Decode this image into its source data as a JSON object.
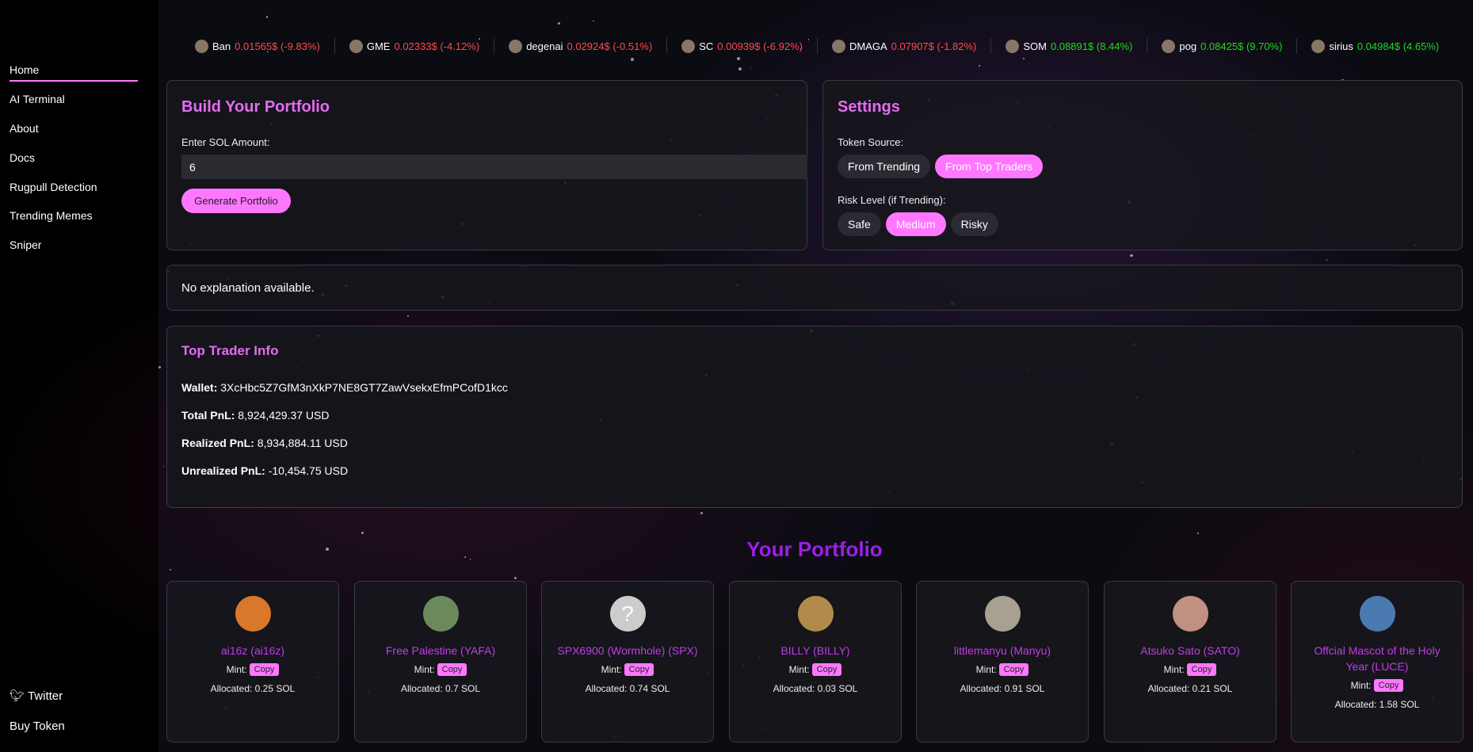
{
  "colors": {
    "accent": "#ff77ff",
    "title": "#e46cf2",
    "portfolio_title": "#9b1fe8",
    "negative": "#ff4a4a",
    "positive": "#1bdc1b"
  },
  "sidebar": {
    "items": [
      {
        "label": "Home",
        "active": true
      },
      {
        "label": "AI Terminal"
      },
      {
        "label": "About"
      },
      {
        "label": "Docs"
      },
      {
        "label": "Rugpull Detection"
      },
      {
        "label": "Trending Memes"
      },
      {
        "label": "Sniper"
      }
    ],
    "twitter": "Twitter",
    "twitter_icon": "bird-icon",
    "buy": "Buy Token"
  },
  "ticker": [
    {
      "name": "Ban",
      "price": "0.01565$",
      "change": "(-9.83%)",
      "dir": "neg"
    },
    {
      "name": "GME",
      "price": "0.02333$",
      "change": "(-4.12%)",
      "dir": "neg"
    },
    {
      "name": "degenai",
      "price": "0.02924$",
      "change": "(-0.51%)",
      "dir": "neg"
    },
    {
      "name": "SC",
      "price": "0.00939$",
      "change": "(-6.92%)",
      "dir": "neg"
    },
    {
      "name": "DMAGA",
      "price": "0.07907$",
      "change": "(-1.82%)",
      "dir": "neg"
    },
    {
      "name": "SOM",
      "price": "0.08891$",
      "change": "(8.44%)",
      "dir": "pos"
    },
    {
      "name": "pog",
      "price": "0.08425$",
      "change": "(9.70%)",
      "dir": "pos"
    },
    {
      "name": "sirius",
      "price": "0.04984$",
      "change": "(4.65%)",
      "dir": "pos"
    }
  ],
  "build": {
    "title": "Build Your Portfolio",
    "label": "Enter SOL Amount:",
    "value": "6",
    "button": "Generate Portfolio"
  },
  "settings": {
    "title": "Settings",
    "source_label": "Token Source:",
    "sources": [
      "From Trending",
      "From Top Traders"
    ],
    "source_selected": "From Top Traders",
    "risk_label": "Risk Level (if Trending):",
    "risks": [
      "Safe",
      "Medium",
      "Risky"
    ],
    "risk_selected": "Medium"
  },
  "explanation": "No explanation available.",
  "trader": {
    "title": "Top Trader Info",
    "wallet_label": "Wallet:",
    "wallet": "3XcHbc5Z7GfM3nXkP7NE8GT7ZawVsekxEfmPCofD1kcc",
    "total_label": "Total PnL:",
    "total": "8,924,429.37 USD",
    "realized_label": "Realized PnL:",
    "realized": "8,934,884.11 USD",
    "unrealized_label": "Unrealized PnL:",
    "unrealized": "-10,454.75 USD"
  },
  "portfolio": {
    "title": "Your Portfolio",
    "mint_label": "Mint:",
    "copy_label": "Copy",
    "cards": [
      {
        "name": "ai16z (ai16z)",
        "allocated": "Allocated: 0.25 SOL",
        "color": "#d9772a"
      },
      {
        "name": "Free Palestine (YAFA)",
        "allocated": "Allocated: 0.7 SOL",
        "color": "#6b8a5a"
      },
      {
        "name": "SPX6900 (Wormhole) (SPX)",
        "allocated": "Allocated: 0.74 SOL",
        "color": "#cccccc"
      },
      {
        "name": "BILLY (BILLY)",
        "allocated": "Allocated: 0.03 SOL",
        "color": "#b08a4a"
      },
      {
        "name": "littlemanyu (Manyu)",
        "allocated": "Allocated: 0.91 SOL",
        "color": "#a8a090"
      },
      {
        "name": "Atsuko Sato (SATO)",
        "allocated": "Allocated: 0.21 SOL",
        "color": "#c09080"
      },
      {
        "name": "Offcial Mascot of the Holy Year (LUCE)",
        "allocated": "Allocated: 1.58 SOL",
        "color": "#4a7ab0"
      }
    ]
  }
}
